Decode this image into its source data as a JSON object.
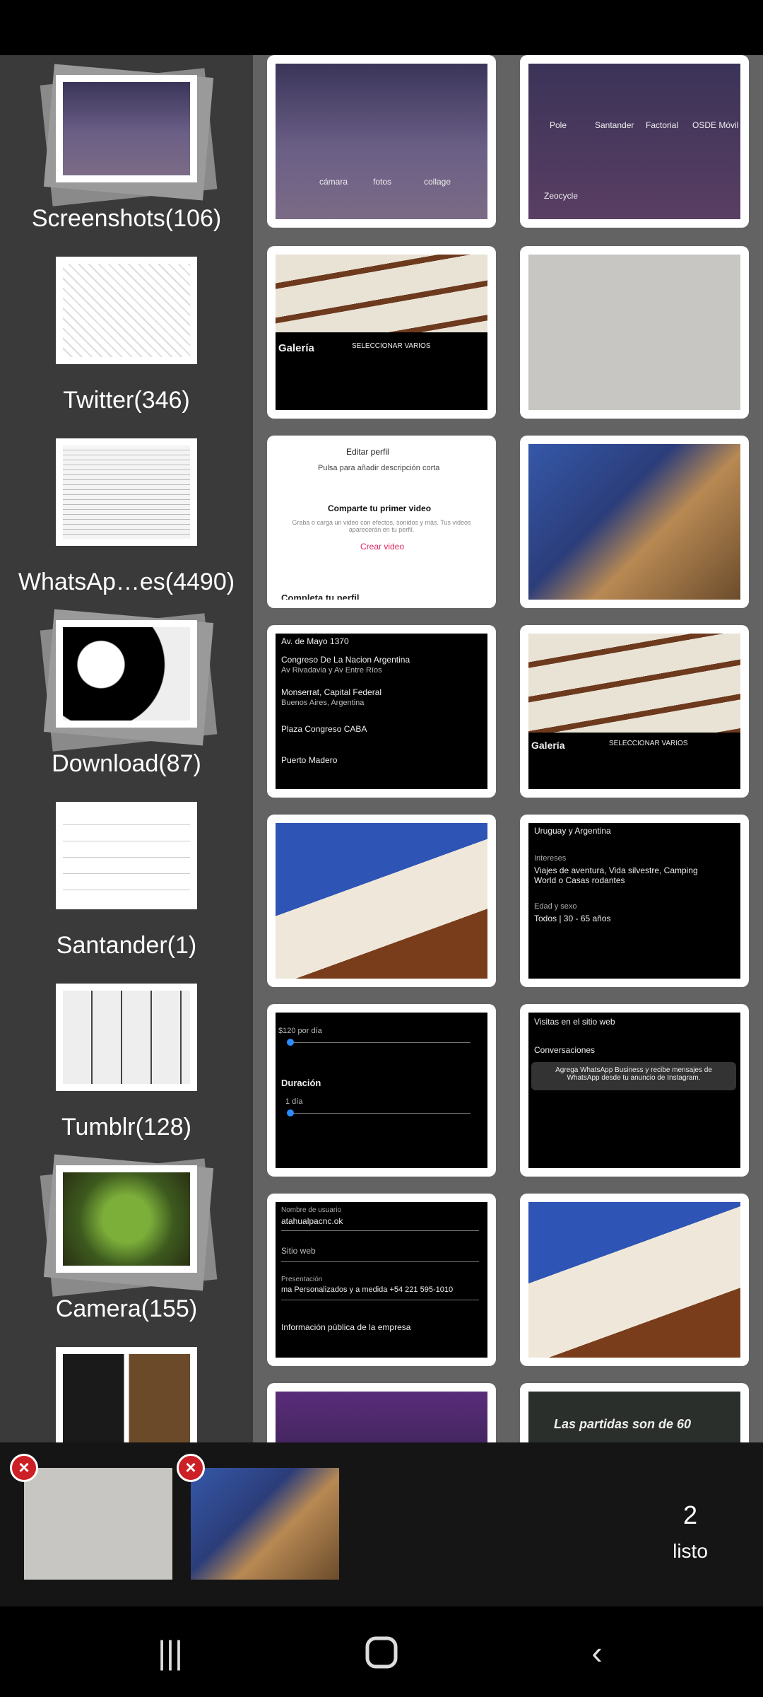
{
  "albums": [
    {
      "label": "Screenshots(106)"
    },
    {
      "label": "Twitter(346)"
    },
    {
      "label": "WhatsAp…es(4490)"
    },
    {
      "label": "Download(87)"
    },
    {
      "label": "Santander(1)"
    },
    {
      "label": "Tumblr(128)"
    },
    {
      "label": "Camera(155)"
    }
  ],
  "thumb_text": {
    "home_icons": [
      "cámara",
      "fotos",
      "collage"
    ],
    "apps": [
      "Pole",
      "Santander",
      "Factorial",
      "OSDE Móvil",
      "Zeocycle"
    ],
    "galeria": "Galería",
    "seleccionar": "SELECCIONAR VARIOS",
    "editar_perfil": "Editar perfil",
    "pulsa": "Pulsa para añadir descripción corta",
    "comparte": "Comparte tu primer video",
    "comparte_sub": "Graba o carga un video con efectos, sonidos y más. Tus videos aparecerán en tu perfil.",
    "crear_video": "Crear video",
    "completa": "Completa tu perfil",
    "addr1": "Av. de Mayo 1370",
    "addr2": "Congreso De La Nacion Argentina",
    "addr3": "Av Rivadavia y Av Entre Ríos",
    "addr4": "Monserrat, Capital Federal",
    "addr5": "Buenos Aires, Argentina",
    "addr6": "Plaza Congreso CABA",
    "addr7": "Puerto Madero",
    "lugares": "Uruguay y Argentina",
    "intereses_label": "Intereses",
    "intereses": "Viajes de aventura, Vida silvestre, Camping World o Casas rodantes",
    "edad_label": "Edad y sexo",
    "edad": "Todos | 30 - 65 años",
    "presupuesto": "$120 por día",
    "duracion_label": "Duración",
    "duracion": "1 día",
    "visitas": "Visitas en el sitio web",
    "conversaciones": "Conversaciones",
    "agrega": "Agrega WhatsApp Business y recibe mensajes de WhatsApp desde tu anuncio de Instagram.",
    "usuario_label": "Nombre de usuario",
    "usuario": "atahualpacnc.ok",
    "sitio": "Sitio web",
    "presentacion_label": "Presentación",
    "presentacion": "ma Personalizados y a medida +54 221 595-1010",
    "info_publica": "Información pública de la empresa",
    "partidas": "Las partidas son de 60"
  },
  "bottom": {
    "count": "2",
    "done_label": "listo"
  },
  "colors": {
    "accent_red": "#cc1f26",
    "sidebar_bg": "#3a3a3a",
    "grid_bg": "#636363"
  },
  "icons": [
    "close-icon",
    "recents-icon",
    "home-icon",
    "back-icon"
  ]
}
